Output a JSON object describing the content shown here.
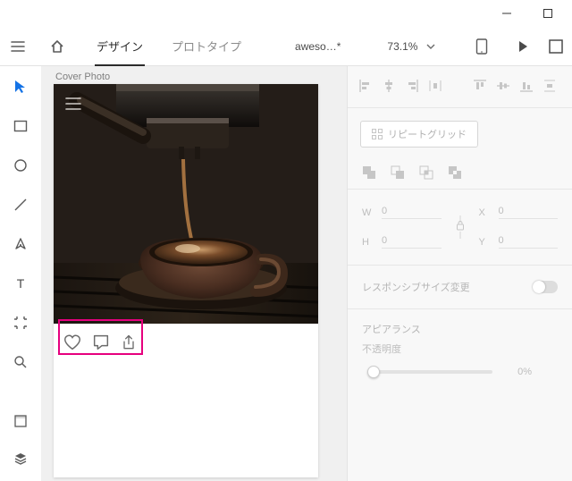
{
  "window": {},
  "topbar": {
    "tabs": {
      "design": "デザイン",
      "prototype": "プロトタイプ",
      "active": "design"
    },
    "document_name": "aweso…*",
    "zoom": "73.1%"
  },
  "tools": {
    "select": "select",
    "rectangle": "rectangle",
    "ellipse": "ellipse",
    "line": "line",
    "pen": "pen",
    "text": "text",
    "artboard": "artboard",
    "zoom": "zoom",
    "assets": "assets",
    "layers": "layers"
  },
  "canvas": {
    "artboard_label": "Cover Photo",
    "action_icons": {
      "heart": "heart-icon",
      "comment": "comment-icon",
      "share": "share-icon"
    }
  },
  "inspector": {
    "repeat_grid_label": "リピートグリッド",
    "dims": {
      "w_label": "W",
      "w_value": "0",
      "h_label": "H",
      "h_value": "0",
      "x_label": "X",
      "x_value": "0",
      "y_label": "Y",
      "y_value": "0"
    },
    "responsive_label": "レスポンシブサイズ変更",
    "appearance_label": "アピアランス",
    "opacity_label": "不透明度",
    "opacity_value": "0%"
  }
}
